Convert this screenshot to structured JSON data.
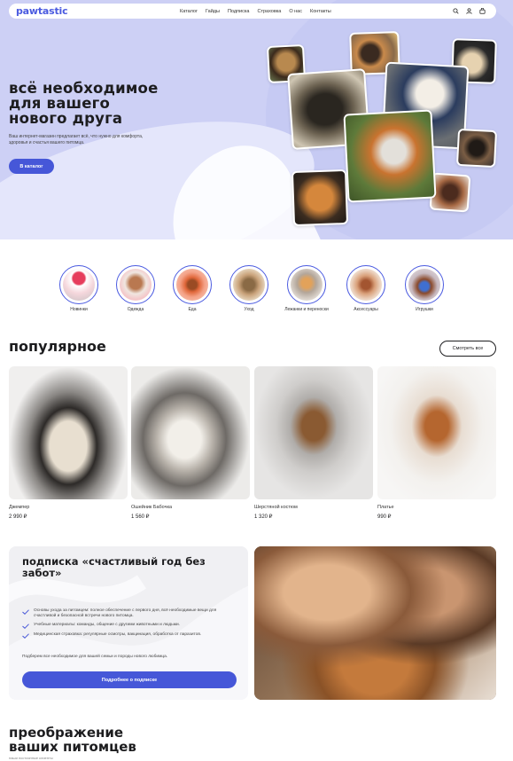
{
  "nav": {
    "logo": "pawtastic",
    "links": [
      "Каталог",
      "Гайды",
      "Подписка",
      "Страховка",
      "О нас",
      "Контакты"
    ],
    "icons": [
      "search-icon",
      "user-icon",
      "cart-icon"
    ]
  },
  "hero": {
    "title_line1": "всё необходимое",
    "title_line2": "для вашего",
    "title_line3": "нового друга",
    "subtitle": "Ваш интернет-магазин предлагает всё, что нужно для комфорта, здоровья и счастья вашего питомца.",
    "cta": "В каталог"
  },
  "categories": [
    "Новинки",
    "Одежда",
    "Еда",
    "Уход",
    "Лежанки и переноски",
    "Аксессуары",
    "Игрушки"
  ],
  "popular": {
    "title": "популярное",
    "see_all": "Смотреть все",
    "products": [
      {
        "name": "Джемпер",
        "price": "2 990 ₽"
      },
      {
        "name": "Ошейник Бабочка",
        "price": "1 560 ₽"
      },
      {
        "name": "Шерстяной костюм",
        "price": "1 320 ₽"
      },
      {
        "name": "Платье",
        "price": "990 ₽"
      }
    ]
  },
  "subscription": {
    "title": "подписка «счастливый год без забот»",
    "items": [
      "Основы ухода за питомцем: полное обеспечение с первого дня, всё необходимые вещи для счастливой и безопасной встречи нового питомца.",
      "Учебные материалы: команды, общение с другими животными и людьми.",
      "Медицинская страховка: регулярные осмотры, вакцинация, обработка от паразитов."
    ],
    "note": "Подберем все необходимое для вашей семьи и породы нового любимца.",
    "button": "Подробнее о подписке"
  },
  "transformation": {
    "title_line1": "преображение",
    "title_line2": "ваших питомцев",
    "subtitle": "наши постоянные клиенты"
  },
  "colors": {
    "accent": "#4657d8",
    "hero_bg": "#cdd0f5",
    "logo": "#4a5ae0"
  }
}
